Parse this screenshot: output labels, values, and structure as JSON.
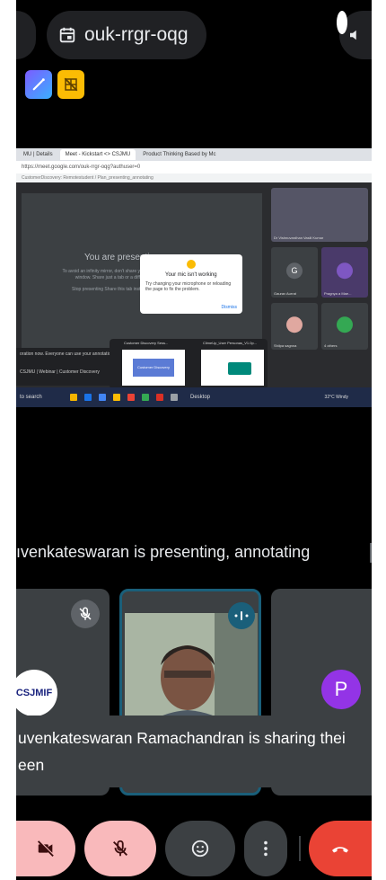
{
  "meeting": {
    "code": "ouk-rrgr-oqg"
  },
  "browser": {
    "tabs": [
      "MU | Details",
      "Meet - Kickstart <> CSJMU",
      "Product Thinking Based by Mc"
    ],
    "url": "https://meet.google.com/ouk-rrgr-oqg?authuser=0",
    "bookmarks": "CustomerDiscovery: Remotestudent / Plan_presenting_annotating"
  },
  "shared_screen": {
    "presenting_title": "You are presenting",
    "presenting_sub": "To avoid an infinity mirror, don't share your entire screen or browser window. Share just a tab or a different window instead.",
    "presenting_buttons": "Stop presenting    Share this tab instead",
    "dialog_title": "Your mic isn't working",
    "dialog_message": "Try changing your microphone or reloading the page to fix the problem.",
    "dialog_dismiss": "Dismiss",
    "annotation_text": "oration now. Everyone can use your annotations",
    "webinar_label": "CSJMU | Webinar | Customer Discovery",
    "thumb1_title": "Customer Discovery Sess...",
    "thumb1_content": "Customer Discovery",
    "thumb2_title": "ClimeUp_User Personas_V1.0p...",
    "tiles": [
      {
        "name": "Dr Vishnuvardhan Vasili Kumar",
        "initial": ""
      },
      {
        "name": "Gaurav Aurrat",
        "initial": "G"
      },
      {
        "name": "Pragnya a Mae...",
        "initial": ""
      },
      {
        "name": "Shilpa sagnna",
        "initial": ""
      },
      {
        "name": "4 others",
        "initial": ""
      }
    ],
    "taskbar_search": "to search",
    "taskbar_desktop": "Desktop",
    "weather": "32°C Windy"
  },
  "presenting_banner": "ıvenkateswaran is presenting, annotating",
  "participants": {
    "logo_text": "CSJMIF",
    "right_initial": "P"
  },
  "toast": {
    "line1": "uvenkateswaran Ramachandran is sharing thei",
    "line2": "een"
  },
  "colors": {
    "end_call": "#ea4335",
    "muted_bg": "#f9b9bb",
    "active_border": "#1a5f7a",
    "avatar": "#9334e6"
  }
}
